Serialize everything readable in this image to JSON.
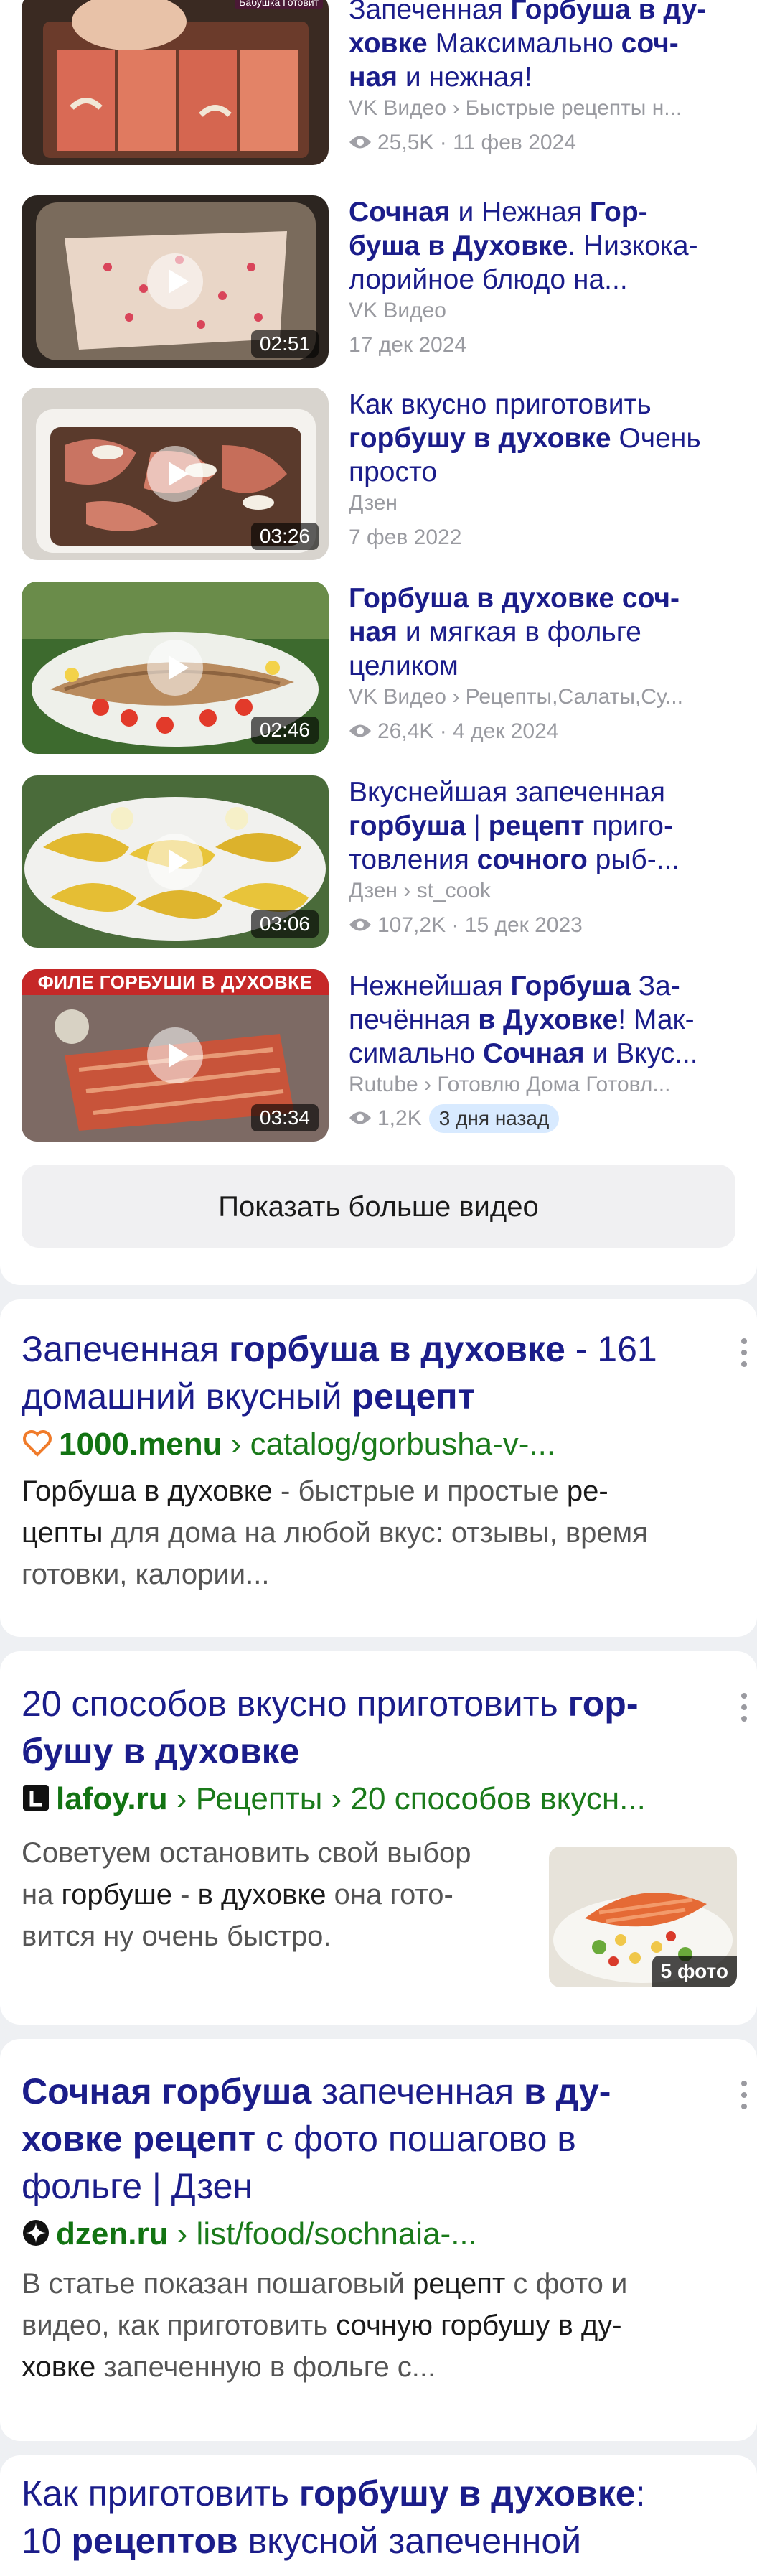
{
  "videos": [
    {
      "title_parts": [
        {
          "t": "Запеченная ",
          "b": false
        },
        {
          "t": "Горбуша в ду-\nховке",
          "b": true
        },
        {
          "t": " Максимально ",
          "b": false
        },
        {
          "t": "соч-\nная",
          "b": true
        },
        {
          "t": " и нежная!",
          "b": false
        }
      ],
      "source": "VK Видео › Быстрые рецепты н...",
      "views": "25,5K",
      "date": "11 фев 2024",
      "duration": "",
      "stamp": "Бабушка Готовит"
    },
    {
      "title_parts": [
        {
          "t": "Сочная",
          "b": true
        },
        {
          "t": " и Нежная ",
          "b": false
        },
        {
          "t": "Гор-\nбуша в Духовке",
          "b": true
        },
        {
          "t": ". Низкока-\nлорийное блюдо на...",
          "b": false
        }
      ],
      "source": "VK Видео",
      "views": "",
      "date": "17 дек 2024",
      "duration": "02:51"
    },
    {
      "title_parts": [
        {
          "t": "Как вкусно приготовить\n",
          "b": false
        },
        {
          "t": "горбушу в духовке",
          "b": true
        },
        {
          "t": " Очень\nпросто",
          "b": false
        }
      ],
      "source": "Дзен",
      "views": "",
      "date": "7 фев 2022",
      "duration": "03:26"
    },
    {
      "title_parts": [
        {
          "t": "Горбуша в духовке соч-\nная",
          "b": true
        },
        {
          "t": " и мягкая в фольге\nцеликом",
          "b": false
        }
      ],
      "source": "VK Видео › Рецепты,Салаты,Су...",
      "views": "26,4K",
      "date": "4 дек 2024",
      "duration": "02:46"
    },
    {
      "title_parts": [
        {
          "t": "Вкуснейшая запеченная\n",
          "b": false
        },
        {
          "t": "горбуша",
          "b": true
        },
        {
          "t": " | ",
          "b": false
        },
        {
          "t": "рецепт",
          "b": true
        },
        {
          "t": " приго-\nтовления ",
          "b": false
        },
        {
          "t": "сочного",
          "b": true
        },
        {
          "t": " рыб-...",
          "b": false
        }
      ],
      "source": "Дзен › st_cook",
      "views": "107,2K",
      "date": "15 дек 2023",
      "duration": "03:06"
    },
    {
      "title_parts": [
        {
          "t": "Нежнейшая ",
          "b": false
        },
        {
          "t": "Горбуша",
          "b": true
        },
        {
          "t": " За-\nпечённая ",
          "b": false
        },
        {
          "t": "в Духовке",
          "b": true
        },
        {
          "t": "! Мак-\nсимально ",
          "b": false
        },
        {
          "t": "Сочная",
          "b": true
        },
        {
          "t": " и Вкус...",
          "b": false
        }
      ],
      "source": "Rutube › Готовлю Дома Готовл...",
      "views": "1,2K",
      "date": "",
      "badge": "3 дня назад",
      "duration": "03:34",
      "banner": "ФИЛЕ ГОРБУШИ В ДУХОВКЕ"
    }
  ],
  "more_videos_label": "Показать больше видео",
  "results": [
    {
      "title_parts": [
        {
          "t": "Запеченная ",
          "b": false
        },
        {
          "t": "горбуша в духовке",
          "b": true
        },
        {
          "t": " - 161\nдомашний вкусный ",
          "b": false
        },
        {
          "t": "рецепт",
          "b": true
        }
      ],
      "domain": "1000.menu",
      "path": " › catalog/gorbusha-v-...",
      "favicon": "heart-icon",
      "snippet_parts": [
        {
          "t": "Горбуша в духовке",
          "b": true
        },
        {
          "t": " - быстрые и простые ",
          "b": false
        },
        {
          "t": "ре-\nцепты",
          "b": true
        },
        {
          "t": " для дома на любой вкус: отзывы, время\nготовки, калории...",
          "b": false
        }
      ]
    },
    {
      "title_parts": [
        {
          "t": "20 способов вкусно приготовить ",
          "b": false
        },
        {
          "t": "гор-\nбушу в духовке",
          "b": true
        }
      ],
      "domain": "lafoy.ru",
      "path": " › Рецепты › 20 способов вкусн...",
      "favicon": "lafoy-icon",
      "snippet_parts": [
        {
          "t": "Советуем остановить свой выбор\nна ",
          "b": false
        },
        {
          "t": "горбуше",
          "b": true
        },
        {
          "t": " - ",
          "b": false
        },
        {
          "t": "в духовке",
          "b": true
        },
        {
          "t": " она гото-\nвится ну очень быстро.",
          "b": false
        }
      ],
      "photo_badge": "5 фото"
    },
    {
      "title_parts": [
        {
          "t": "Сочная горбуша",
          "b": true
        },
        {
          "t": " запеченная ",
          "b": false
        },
        {
          "t": "в ду-\nховке рецепт",
          "b": true
        },
        {
          "t": " с фото пошагово в\nфольге | Дзен",
          "b": false
        }
      ],
      "domain": "dzen.ru",
      "path": " › list/food/sochnaia-...",
      "favicon": "dzen-icon",
      "snippet_parts": [
        {
          "t": "В статье показан пошаговый ",
          "b": false
        },
        {
          "t": "рецепт",
          "b": true
        },
        {
          "t": " с фото и\nвидео, как приготовить ",
          "b": false
        },
        {
          "t": "сочную горбушу в ду-\nховке",
          "b": true
        },
        {
          "t": " запеченную в фольге с...",
          "b": false
        }
      ]
    },
    {
      "title_parts": [
        {
          "t": "Как приготовить ",
          "b": false
        },
        {
          "t": "горбушу в духовке",
          "b": true
        },
        {
          "t": ":\n10 ",
          "b": false
        },
        {
          "t": "рецептов",
          "b": true
        },
        {
          "t": " вкусной запеченной",
          "b": false
        }
      ]
    }
  ],
  "colors": {
    "title": "#1b1d8a",
    "url": "#1a7a1a",
    "meta": "#999aa0",
    "badge_bg": "#d8eaff"
  }
}
